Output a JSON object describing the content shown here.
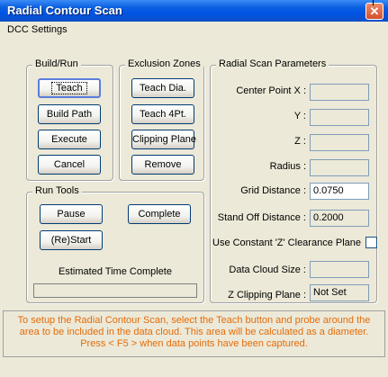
{
  "window": {
    "title": "Radial Contour Scan",
    "close_glyph": "✕"
  },
  "menu": {
    "items": [
      {
        "label": "DCC Settings"
      }
    ]
  },
  "build_run": {
    "legend": "Build/Run",
    "teach": "Teach",
    "build_path": "Build Path",
    "execute": "Execute",
    "cancel": "Cancel"
  },
  "exclusion_zones": {
    "legend": "Exclusion Zones",
    "teach_dia": "Teach Dia.",
    "teach_4pt": "Teach 4Pt.",
    "clipping_plane": "Clipping Plane",
    "remove": "Remove"
  },
  "run_tools": {
    "legend": "Run Tools",
    "pause": "Pause",
    "complete": "Complete",
    "restart": "(Re)Start",
    "estimated_time_label": "Estimated Time Complete",
    "estimated_time_value": ""
  },
  "radial_scan_parameters": {
    "legend": "Radial Scan Parameters",
    "center_point_x_label": "Center Point X :",
    "center_point_x_value": "",
    "y_label": "Y :",
    "y_value": "",
    "z_label": "Z :",
    "z_value": "",
    "radius_label": "Radius :",
    "radius_value": "",
    "grid_distance_label": "Grid Distance :",
    "grid_distance_value": "0.0750",
    "stand_off_label": "Stand Off Distance :",
    "stand_off_value": "0.2000",
    "constant_z_label": "Use Constant 'Z' Clearance Plane",
    "constant_z_checked": false,
    "data_cloud_size_label": "Data Cloud Size :",
    "data_cloud_size_value": "",
    "z_clipping_label": "Z Clipping Plane :",
    "z_clipping_value": "Not Set"
  },
  "status": {
    "message": "To setup the Radial Contour Scan, select the Teach button and probe around the area to be included in the data cloud. This area will be calculated as a diameter.  Press < F5 > when data points have been captured."
  },
  "colors": {
    "title_bar": "#0054e3",
    "status_text": "#e46c0a",
    "dialog_bg": "#ece9d8",
    "close_button": "#d4512c"
  }
}
